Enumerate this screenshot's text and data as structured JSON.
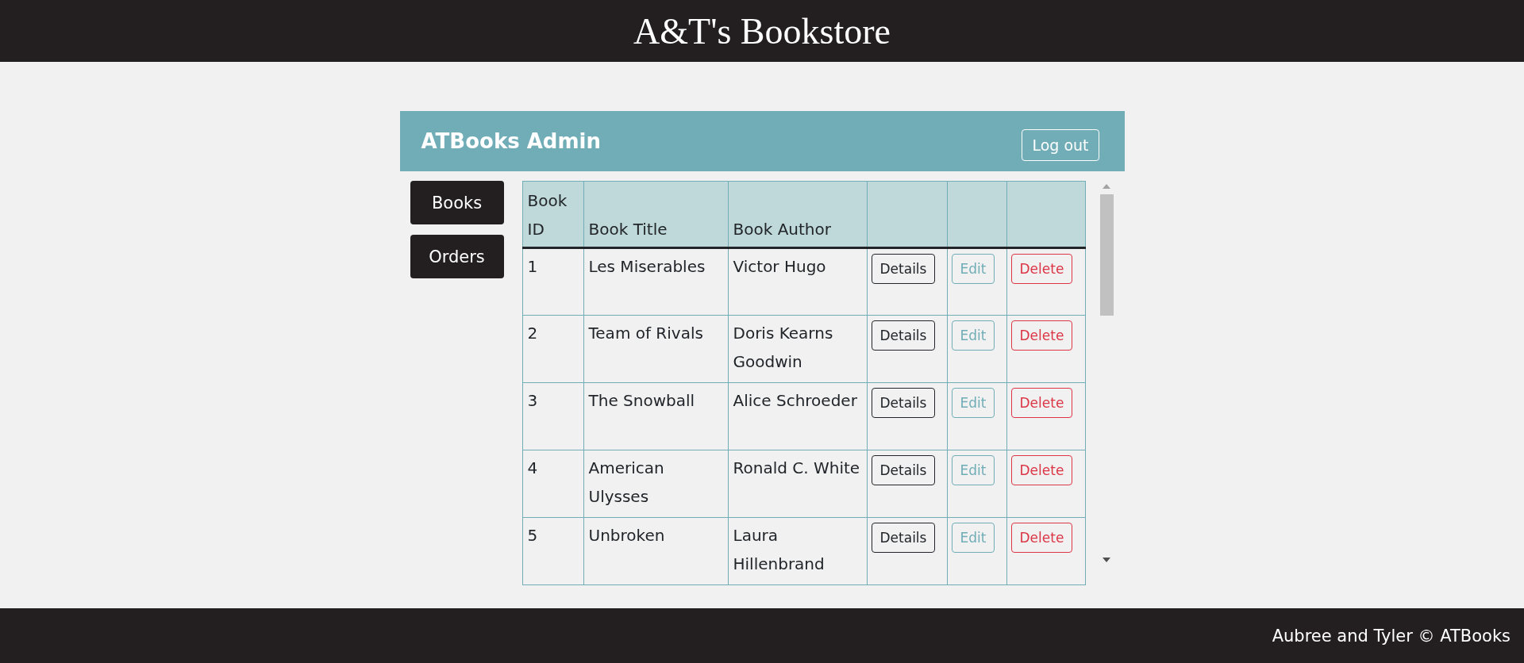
{
  "site_header": {
    "title": "A&T's Bookstore"
  },
  "admin_panel": {
    "title": "ATBooks Admin",
    "logout_button": "Log out"
  },
  "sidebar": {
    "items": [
      "Books",
      "Orders"
    ]
  },
  "table": {
    "columns": [
      "Book ID",
      "Book Title",
      "Book Author",
      "",
      "",
      ""
    ],
    "rows": [
      {
        "cells": [
          "1",
          "Les Miserables",
          "Victor Hugo"
        ],
        "actions": [
          {
            "label": "Details",
            "kind": "details"
          },
          {
            "label": "Edit",
            "kind": "edit"
          },
          {
            "label": "Delete",
            "kind": "delete"
          }
        ]
      },
      {
        "cells": [
          "2",
          "Team of Rivals",
          "Doris Kearns Goodwin"
        ],
        "actions": [
          {
            "label": "Details",
            "kind": "details"
          },
          {
            "label": "Edit",
            "kind": "edit"
          },
          {
            "label": "Delete",
            "kind": "delete"
          }
        ]
      },
      {
        "cells": [
          "3",
          "The Snowball",
          "Alice Schroeder"
        ],
        "actions": [
          {
            "label": "Details",
            "kind": "details"
          },
          {
            "label": "Edit",
            "kind": "edit"
          },
          {
            "label": "Delete",
            "kind": "delete"
          }
        ]
      },
      {
        "cells": [
          "4",
          "American Ulysses",
          "Ronald C. White"
        ],
        "actions": [
          {
            "label": "Details",
            "kind": "details"
          },
          {
            "label": "Edit",
            "kind": "edit"
          },
          {
            "label": "Delete",
            "kind": "delete"
          }
        ]
      },
      {
        "cells": [
          "5",
          "Unbroken",
          "Laura Hillenbrand"
        ],
        "actions": [
          {
            "label": "Details",
            "kind": "details"
          },
          {
            "label": "Edit",
            "kind": "edit"
          },
          {
            "label": "Delete",
            "kind": "delete"
          }
        ]
      }
    ]
  },
  "footer": {
    "text": "Aubree and Tyler © ATBooks"
  }
}
